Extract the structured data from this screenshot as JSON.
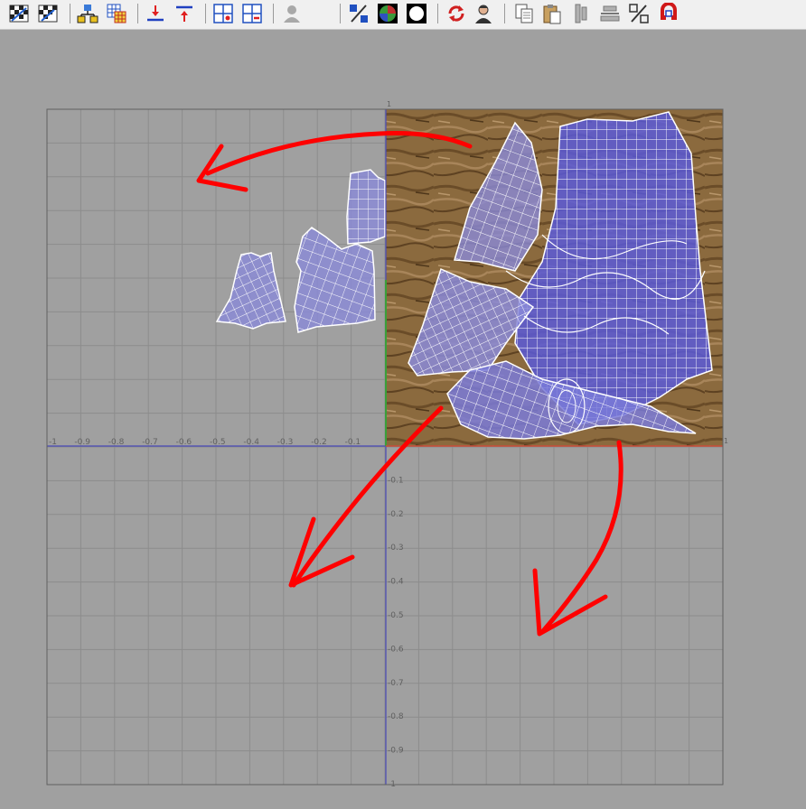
{
  "toolbar": {
    "buttons": [
      {
        "id": "checker-map",
        "icon": "checker-map-icon"
      },
      {
        "id": "checker-map-2",
        "icon": "checker-map-alt-icon"
      },
      {
        "id": "hierarchy",
        "icon": "hierarchy-icon"
      },
      {
        "id": "grid-tiles",
        "icon": "grid-tiles-icon"
      },
      {
        "id": "move-down",
        "icon": "arrow-down-line-icon"
      },
      {
        "id": "move-up",
        "icon": "arrow-up-line-icon"
      },
      {
        "id": "grid-add",
        "icon": "grid-add-icon"
      },
      {
        "id": "grid-remove",
        "icon": "grid-remove-icon"
      },
      {
        "id": "user-disabled",
        "icon": "user-gray-icon"
      },
      {
        "id": "percent-map",
        "icon": "percent-map-icon"
      },
      {
        "id": "texture-sphere",
        "icon": "texture-sphere-icon"
      },
      {
        "id": "circle-mask",
        "icon": "circle-mask-icon"
      },
      {
        "id": "refresh",
        "icon": "refresh-icon"
      },
      {
        "id": "user",
        "icon": "user-icon"
      },
      {
        "id": "copy",
        "icon": "copy-icon"
      },
      {
        "id": "paste",
        "icon": "paste-icon"
      },
      {
        "id": "align-vertical",
        "icon": "align-vertical-icon"
      },
      {
        "id": "align-horizontal",
        "icon": "align-horizontal-icon"
      },
      {
        "id": "percent",
        "icon": "percent-icon"
      },
      {
        "id": "magnet",
        "icon": "magnet-icon"
      }
    ]
  },
  "uv_editor": {
    "x_axis_labels": [
      "-1",
      "-0.9",
      "-0.8",
      "-0.7",
      "-0.6",
      "-0.5",
      "-0.4",
      "-0.3",
      "-0.2",
      "-0.1"
    ],
    "y_axis_labels": [
      "-0.1",
      "-0.2",
      "-0.3",
      "-0.4",
      "-0.5",
      "-0.6",
      "-0.7",
      "-0.8",
      "-0.9",
      "-1"
    ],
    "top_label": "1",
    "right_label": "1",
    "colors": {
      "background": "#a0a0a0",
      "grid": "#8c8c8c",
      "axis": "#4a4ab8",
      "texture": "#8b6a3e",
      "mesh_fill": "#6868e0",
      "wire": "#ffffff",
      "arrow": "#ff0000"
    }
  }
}
